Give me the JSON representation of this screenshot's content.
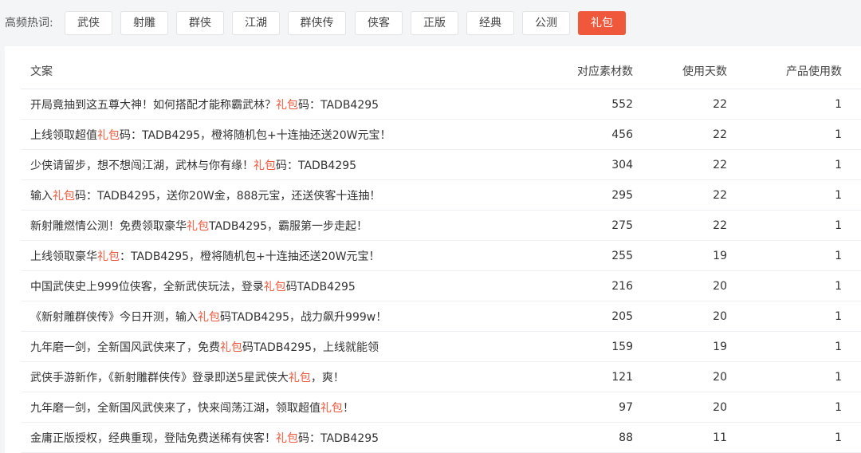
{
  "tagbar": {
    "label": "高频热词:",
    "tags": [
      "武侠",
      "射雕",
      "群侠",
      "江湖",
      "群侠传",
      "侠客",
      "正版",
      "经典",
      "公测",
      "礼包"
    ],
    "active_index": 9
  },
  "table": {
    "headers": {
      "text": "文案",
      "materials": "对应素材数",
      "days": "使用天数",
      "products": "产品使用数"
    },
    "highlight_word": "礼包",
    "highlight_color": "#f0583c",
    "rows": [
      {
        "text": "开局竟抽到这五尊大神！如何搭配才能称霸武林？礼包码：TADB4295",
        "materials": "552",
        "days": "22",
        "products": "1"
      },
      {
        "text": "上线领取超值礼包码：TADB4295，橙将随机包+十连抽还送20W元宝！",
        "materials": "456",
        "days": "22",
        "products": "1"
      },
      {
        "text": "少侠请留步，想不想闯江湖，武林与你有缘！礼包码：TADB4295",
        "materials": "304",
        "days": "22",
        "products": "1"
      },
      {
        "text": "输入礼包码：TADB4295，送你20W金，888元宝，还送侠客十连抽！",
        "materials": "295",
        "days": "22",
        "products": "1"
      },
      {
        "text": "新射雕燃情公测！免费领取豪华礼包TADB4295，霸服第一步走起！",
        "materials": "275",
        "days": "22",
        "products": "1"
      },
      {
        "text": "上线领取豪华礼包：TADB4295，橙将随机包+十连抽还送20W元宝！",
        "materials": "255",
        "days": "19",
        "products": "1"
      },
      {
        "text": "中国武侠史上999位侠客，全新武侠玩法，登录礼包码TADB4295",
        "materials": "216",
        "days": "20",
        "products": "1"
      },
      {
        "text": "《新射雕群侠传》今日开测，输入礼包码TADB4295，战力飙升999w！",
        "materials": "205",
        "days": "20",
        "products": "1"
      },
      {
        "text": "九年磨一剑，全新国风武侠来了，免费礼包码TADB4295，上线就能领",
        "materials": "159",
        "days": "19",
        "products": "1"
      },
      {
        "text": "武侠手游新作，《新射雕群侠传》登录即送5星武侠大礼包，爽！",
        "materials": "121",
        "days": "20",
        "products": "1"
      },
      {
        "text": "九年磨一剑，全新国风武侠来了，快来闯荡江湖，领取超值礼包！",
        "materials": "97",
        "days": "20",
        "products": "1"
      },
      {
        "text": "金庸正版授权，经典重现，登陆免费送稀有侠客！礼包码：TADB4295",
        "materials": "88",
        "days": "11",
        "products": "1"
      }
    ]
  }
}
